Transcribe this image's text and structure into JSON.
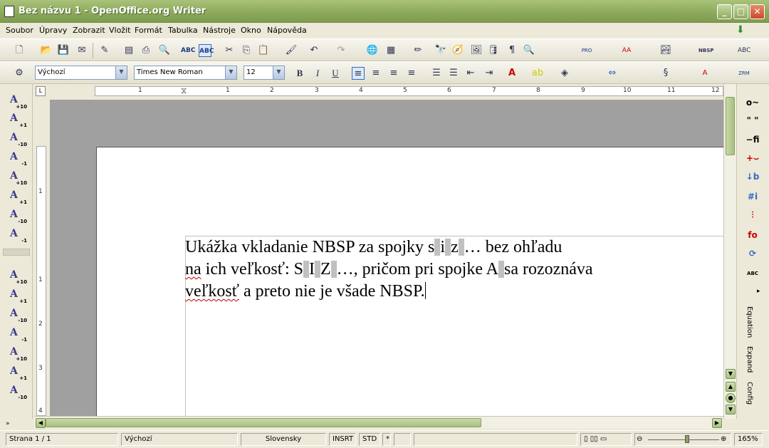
{
  "window": {
    "title": "Bez názvu 1 - OpenOffice.org Writer"
  },
  "menu": [
    "Soubor",
    "Úpravy",
    "Zobrazit",
    "Vložit",
    "Formát",
    "Tabulka",
    "Nástroje",
    "Okno",
    "Nápověda"
  ],
  "formatting": {
    "style": "Výchozí",
    "font": "Times New Roman",
    "size": "12"
  },
  "ruler": {
    "h_ticks": [
      "1",
      "1",
      "2",
      "3",
      "4",
      "5",
      "6",
      "7",
      "8",
      "9",
      "10",
      "11",
      "12"
    ],
    "v_ticks": [
      "1",
      "1",
      "2",
      "3",
      "4"
    ]
  },
  "document": {
    "line1_a": "Ukážka vkladanie NBSP za spojky s",
    "line1_b": "i",
    "line1_c": "z",
    "line1_d": "…  bez ohľadu",
    "line2_a": "na",
    "line2_b": " ich veľkosť: S",
    "line2_c": "I",
    "line2_d": "Z",
    "line2_e": "…, pričom pri spojke A",
    "line2_f": "sa rozoznáva",
    "line3_a": "veľkosť",
    "line3_b": " a preto nie je všade NBSP."
  },
  "right_panel": {
    "labels": [
      "Equation",
      "Expand",
      "Config"
    ]
  },
  "status": {
    "page": "Strana 1 / 1",
    "style": "Výchozí",
    "language": "Slovensky",
    "insert_mode": "INSRT",
    "selection_mode": "STD",
    "modified": "*",
    "zoom": "165%"
  }
}
